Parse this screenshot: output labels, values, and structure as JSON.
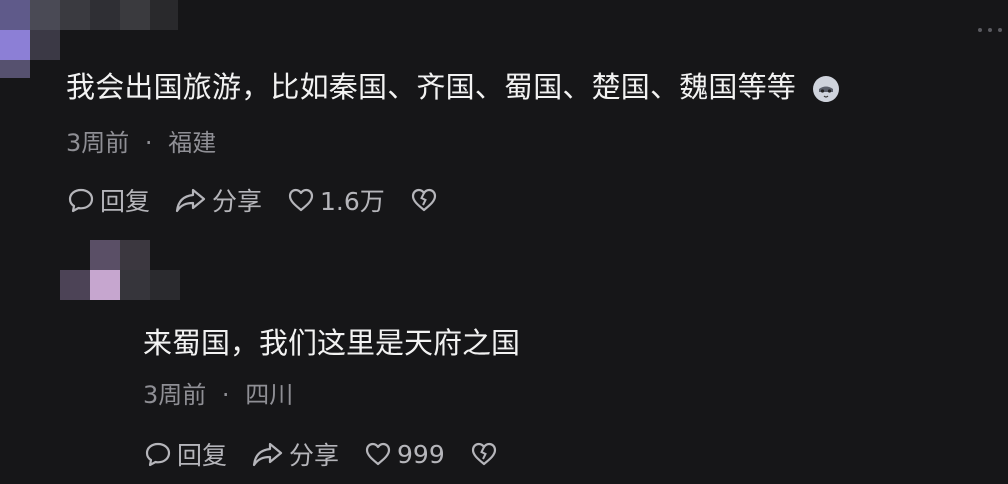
{
  "comment_top": {
    "text": "我会出国旅游，比如秦国、齐国、蜀国、楚国、魏国等等",
    "emoji": "cat-face-emoji",
    "time": "3周前",
    "separator": "·",
    "location": "福建",
    "reply_label": "回复",
    "share_label": "分享",
    "like_count": "1.6万"
  },
  "comment_reply": {
    "text": "来蜀国，我们这里是天府之国",
    "time": "3周前",
    "separator": "·",
    "location": "四川",
    "reply_label": "回复",
    "share_label": "分享",
    "like_count": "999"
  },
  "colors": {
    "background": "#161618",
    "text": "#f2f2f2",
    "meta": "#8f8f95",
    "actions": "#b5b5ba",
    "avatar_blur_purple": "#8c7fd6",
    "avatar_blur_lilac": "#c6a6cf"
  },
  "icons": [
    "comment-bubble-icon",
    "share-arrow-icon",
    "heart-icon",
    "broken-heart-icon",
    "more-options-icon"
  ]
}
